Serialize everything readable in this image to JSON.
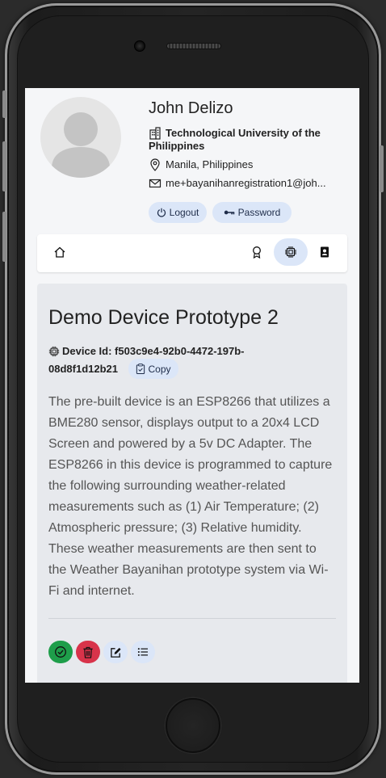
{
  "profile": {
    "name": "John Delizo",
    "organization": "Technological University of the Philippines",
    "location": "Manila, Philippines",
    "email": "me+bayanihanregistration1@joh...",
    "logout_label": "Logout",
    "password_label": "Password"
  },
  "nav": {
    "items": [
      {
        "icon": "home-icon"
      },
      {
        "icon": "award-icon"
      },
      {
        "icon": "cpu-icon",
        "active": true
      },
      {
        "icon": "contact-icon"
      }
    ]
  },
  "device": {
    "title": "Demo Device Prototype 2",
    "id_label": "Device Id:",
    "id_value": "f503c9e4-92b0-4472-197b-08d8f1d12b21",
    "copy_label": "Copy",
    "description": "The pre-built device is an ESP8266 that utilizes a BME280 sensor, displays output to a 20x4 LCD Screen and powered by a 5v DC Adapter. The ESP8266 in this device is programmed to capture the following surrounding weather-related measurements such as (1) Air Temperature; (2) Atmospheric pressure; (3) Relative humidity. These weather measurements are then sent to the Weather Bayanihan prototype system via Wi-Fi and internet."
  },
  "actions": [
    {
      "icon": "check-circle-icon",
      "color": "#1e9e4a"
    },
    {
      "icon": "trash-icon",
      "color": "#d8334a"
    },
    {
      "icon": "edit-icon",
      "color": "#dbe6f8"
    },
    {
      "icon": "list-icon",
      "color": "#dbe6f8"
    }
  ],
  "colors": {
    "accent_pill": "#dbe6f8",
    "card_bg": "#e7e9ed",
    "success": "#1e9e4a",
    "danger": "#d8334a"
  }
}
